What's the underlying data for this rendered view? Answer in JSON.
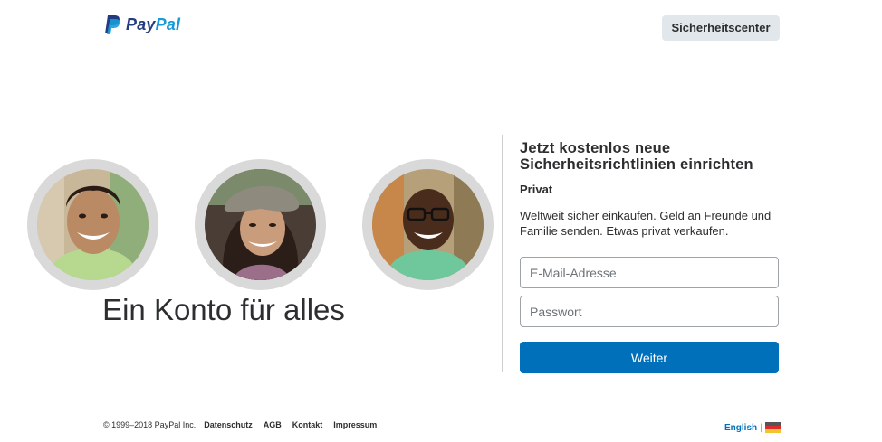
{
  "header": {
    "logo": {
      "pay": "Pay",
      "pal": "Pal",
      "icon": "paypal-mark"
    },
    "security_center_label": "Sicherheitscenter"
  },
  "hero": {
    "avatars": [
      "portrait-man-smiling",
      "portrait-woman-hat",
      "portrait-man-glasses"
    ],
    "headline": "Ein Konto für alles"
  },
  "signup": {
    "title": "Jetzt kostenlos neue Sicherheitsrichtlinien einrichten",
    "subtitle": "Privat",
    "description": "Weltweit sicher einkaufen. Geld an Freunde und Familie senden. Etwas privat verkaufen.",
    "email_placeholder": "E-Mail-Adresse",
    "email_value": "",
    "password_placeholder": "Passwort",
    "password_value": "",
    "submit_label": "Weiter"
  },
  "footer": {
    "copyright": "© 1999–2018 PayPal Inc.",
    "links": [
      "Datenschutz",
      "AGB",
      "Kontakt",
      "Impressum"
    ],
    "language": "English",
    "separator": "|",
    "flag_icon": "german-flag-icon"
  },
  "colors": {
    "brand_dark": "#253b80",
    "brand_light": "#179bd7",
    "button_blue": "#0070ba",
    "security_button_bg": "#e1e7eb"
  }
}
